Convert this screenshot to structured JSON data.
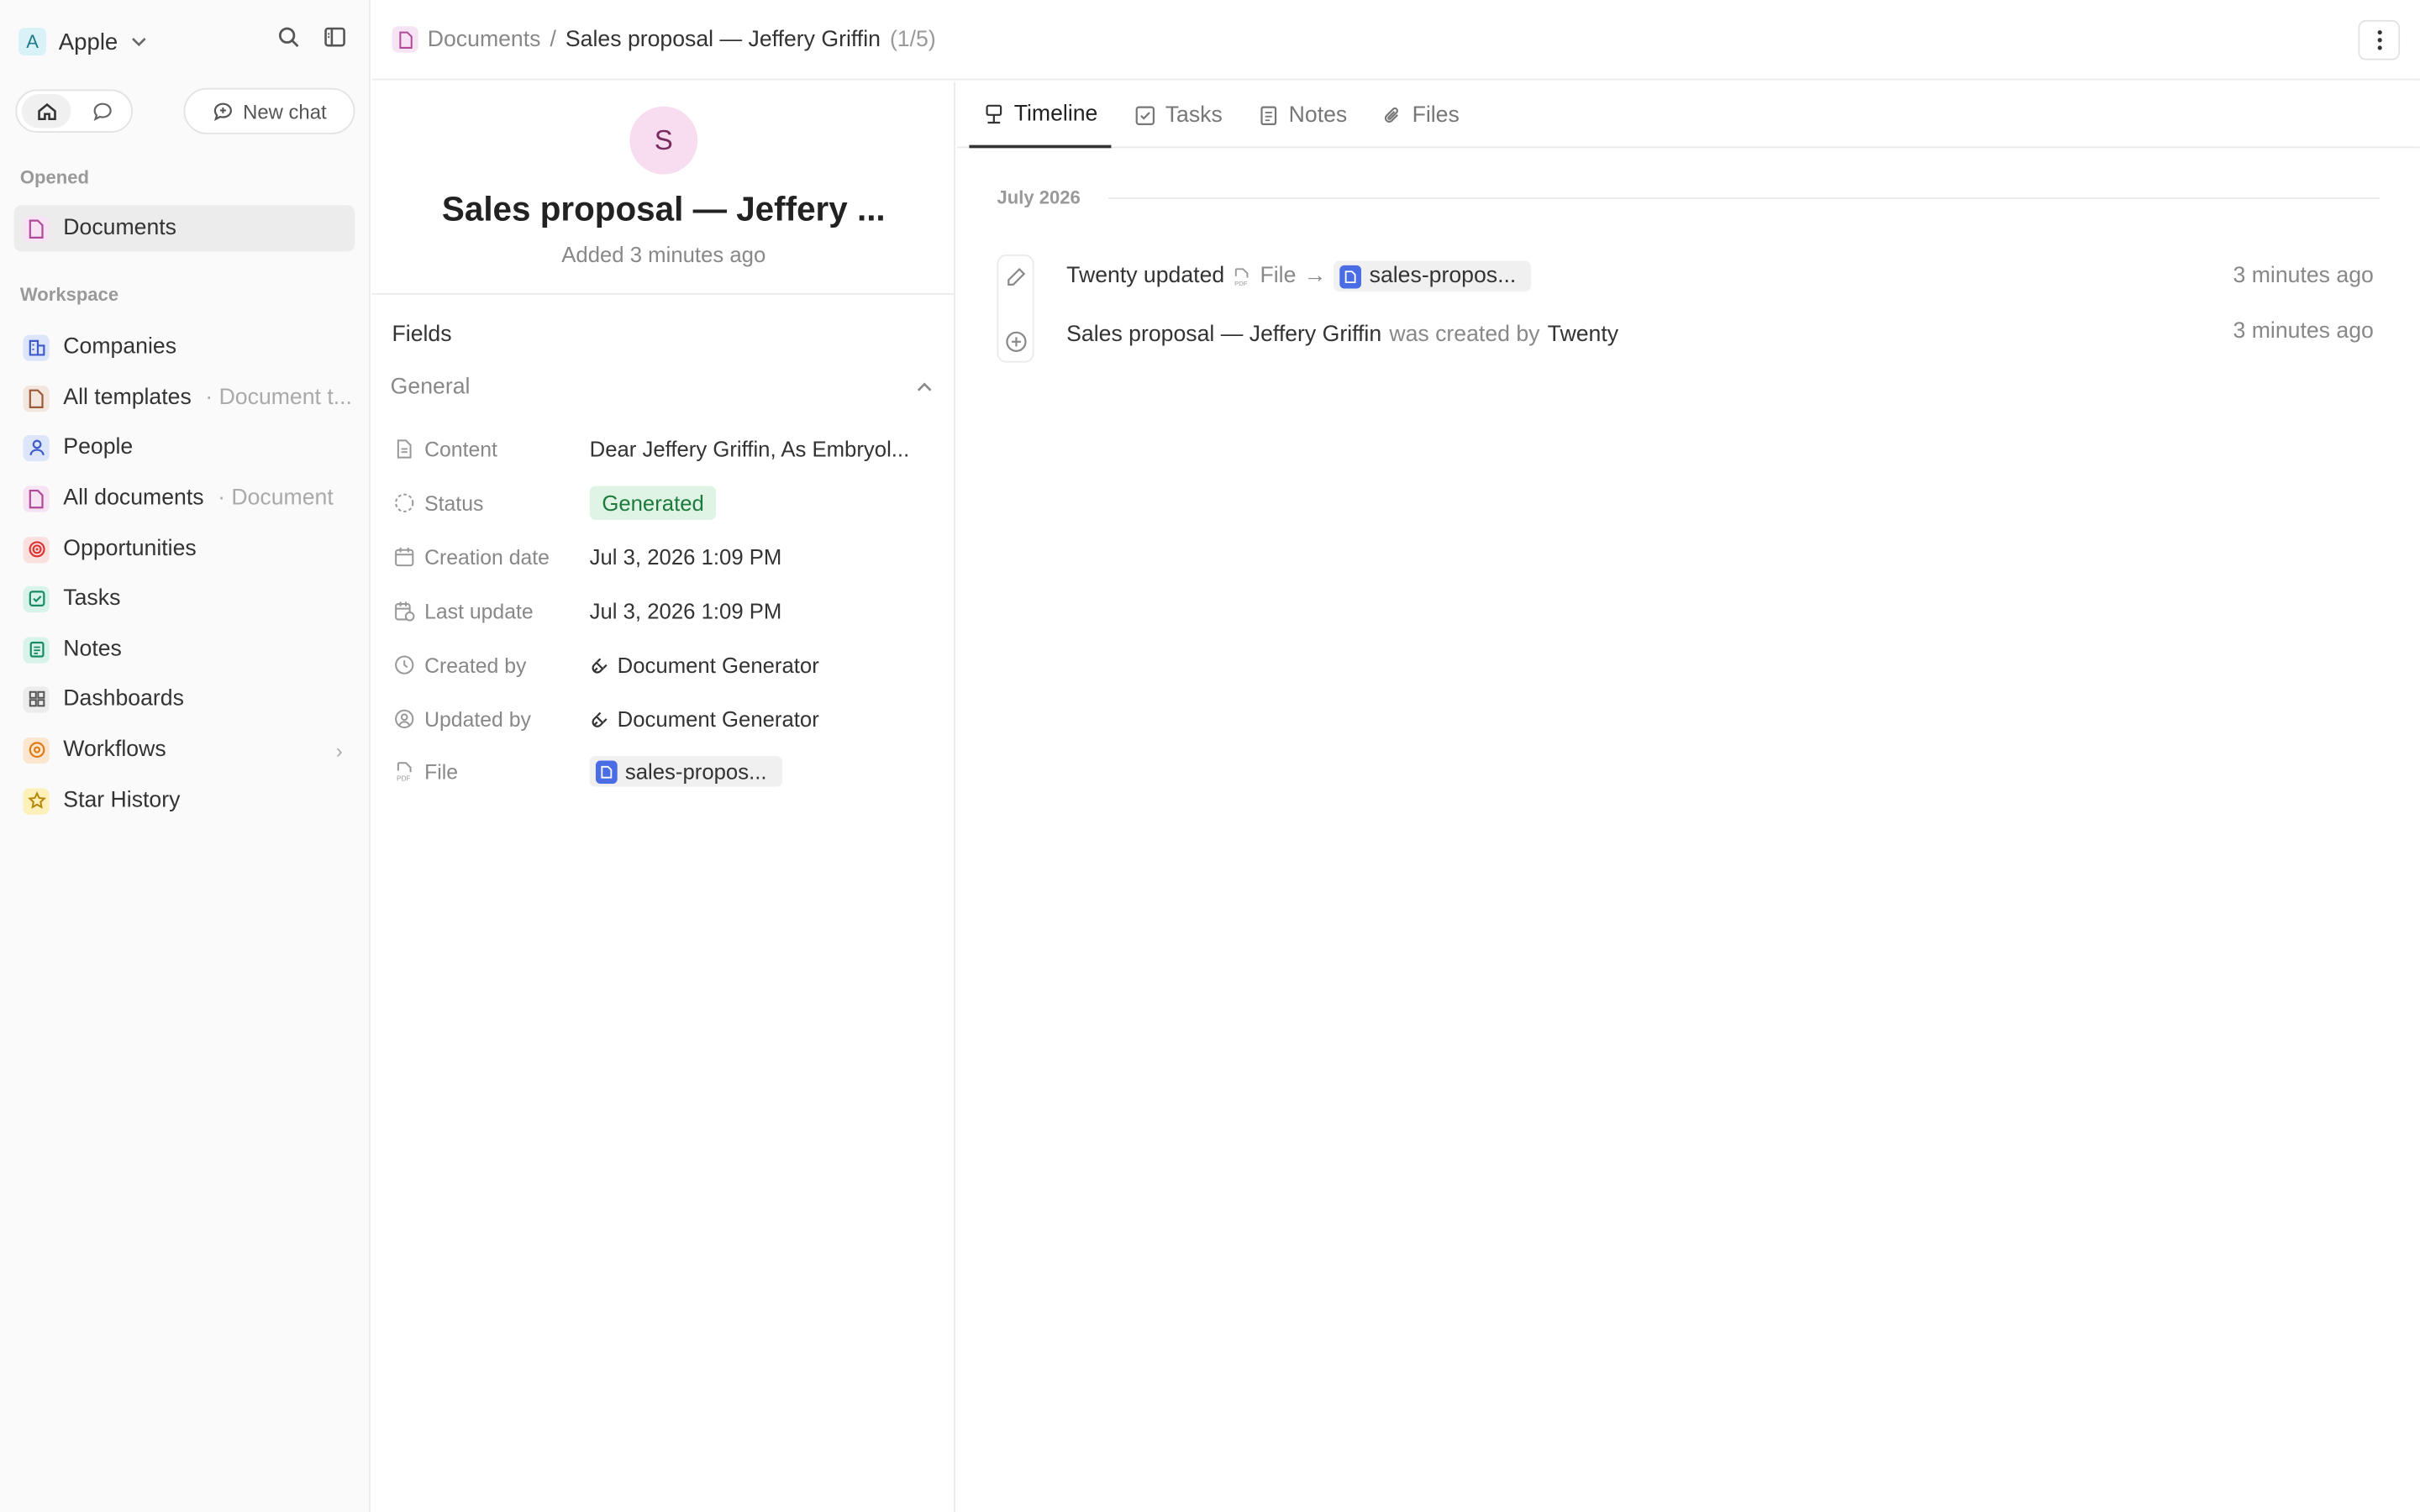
{
  "workspace": {
    "initial": "A",
    "name": "Apple"
  },
  "sidebar": {
    "new_chat": "New chat",
    "opened_label": "Opened",
    "opened": [
      {
        "label": "Documents"
      }
    ],
    "workspace_label": "Workspace",
    "items": [
      {
        "label": "Companies",
        "sub": ""
      },
      {
        "label": "All templates",
        "sub": "· Document t..."
      },
      {
        "label": "People",
        "sub": ""
      },
      {
        "label": "All documents",
        "sub": "· Document"
      },
      {
        "label": "Opportunities",
        "sub": ""
      },
      {
        "label": "Tasks",
        "sub": ""
      },
      {
        "label": "Notes",
        "sub": ""
      },
      {
        "label": "Dashboards",
        "sub": ""
      },
      {
        "label": "Workflows",
        "sub": ""
      },
      {
        "label": "Star History",
        "sub": ""
      }
    ]
  },
  "breadcrumb": {
    "parent": "Documents",
    "sep": "/",
    "current": "Sales proposal — Jeffery Griffin",
    "count": "(1/5)"
  },
  "record": {
    "avatar": "S",
    "title": "Sales proposal — Jeffery ...",
    "subtitle": "Added 3 minutes ago",
    "fields_heading": "Fields",
    "group": "General",
    "fields": [
      {
        "label": "Content",
        "value": "Dear Jeffery Griffin, As Embryol..."
      },
      {
        "label": "Status",
        "value": "Generated"
      },
      {
        "label": "Creation date",
        "value": "Jul 3, 2026 1:09 PM"
      },
      {
        "label": "Last update",
        "value": "Jul 3, 2026 1:09 PM"
      },
      {
        "label": "Created by",
        "value": "Document Generator"
      },
      {
        "label": "Updated by",
        "value": "Document Generator"
      },
      {
        "label": "File",
        "value": "sales-propos..."
      }
    ]
  },
  "tabs": [
    "Timeline",
    "Tasks",
    "Notes",
    "Files"
  ],
  "timeline": {
    "month": "July 2026",
    "events": [
      {
        "actor": "Twenty updated",
        "field": "File",
        "arrow": "→",
        "file": "sales-propos...",
        "time": "3 minutes ago"
      },
      {
        "subject": "Sales proposal — Jeffery Griffin",
        "verb": "was created by",
        "actor": "Twenty",
        "time": "3 minutes ago"
      }
    ]
  },
  "colors": {
    "accent": "#333333",
    "status_green_bg": "#e0f4e6",
    "status_green_fg": "#1e7a3c",
    "file_blue": "#4a6de5"
  }
}
